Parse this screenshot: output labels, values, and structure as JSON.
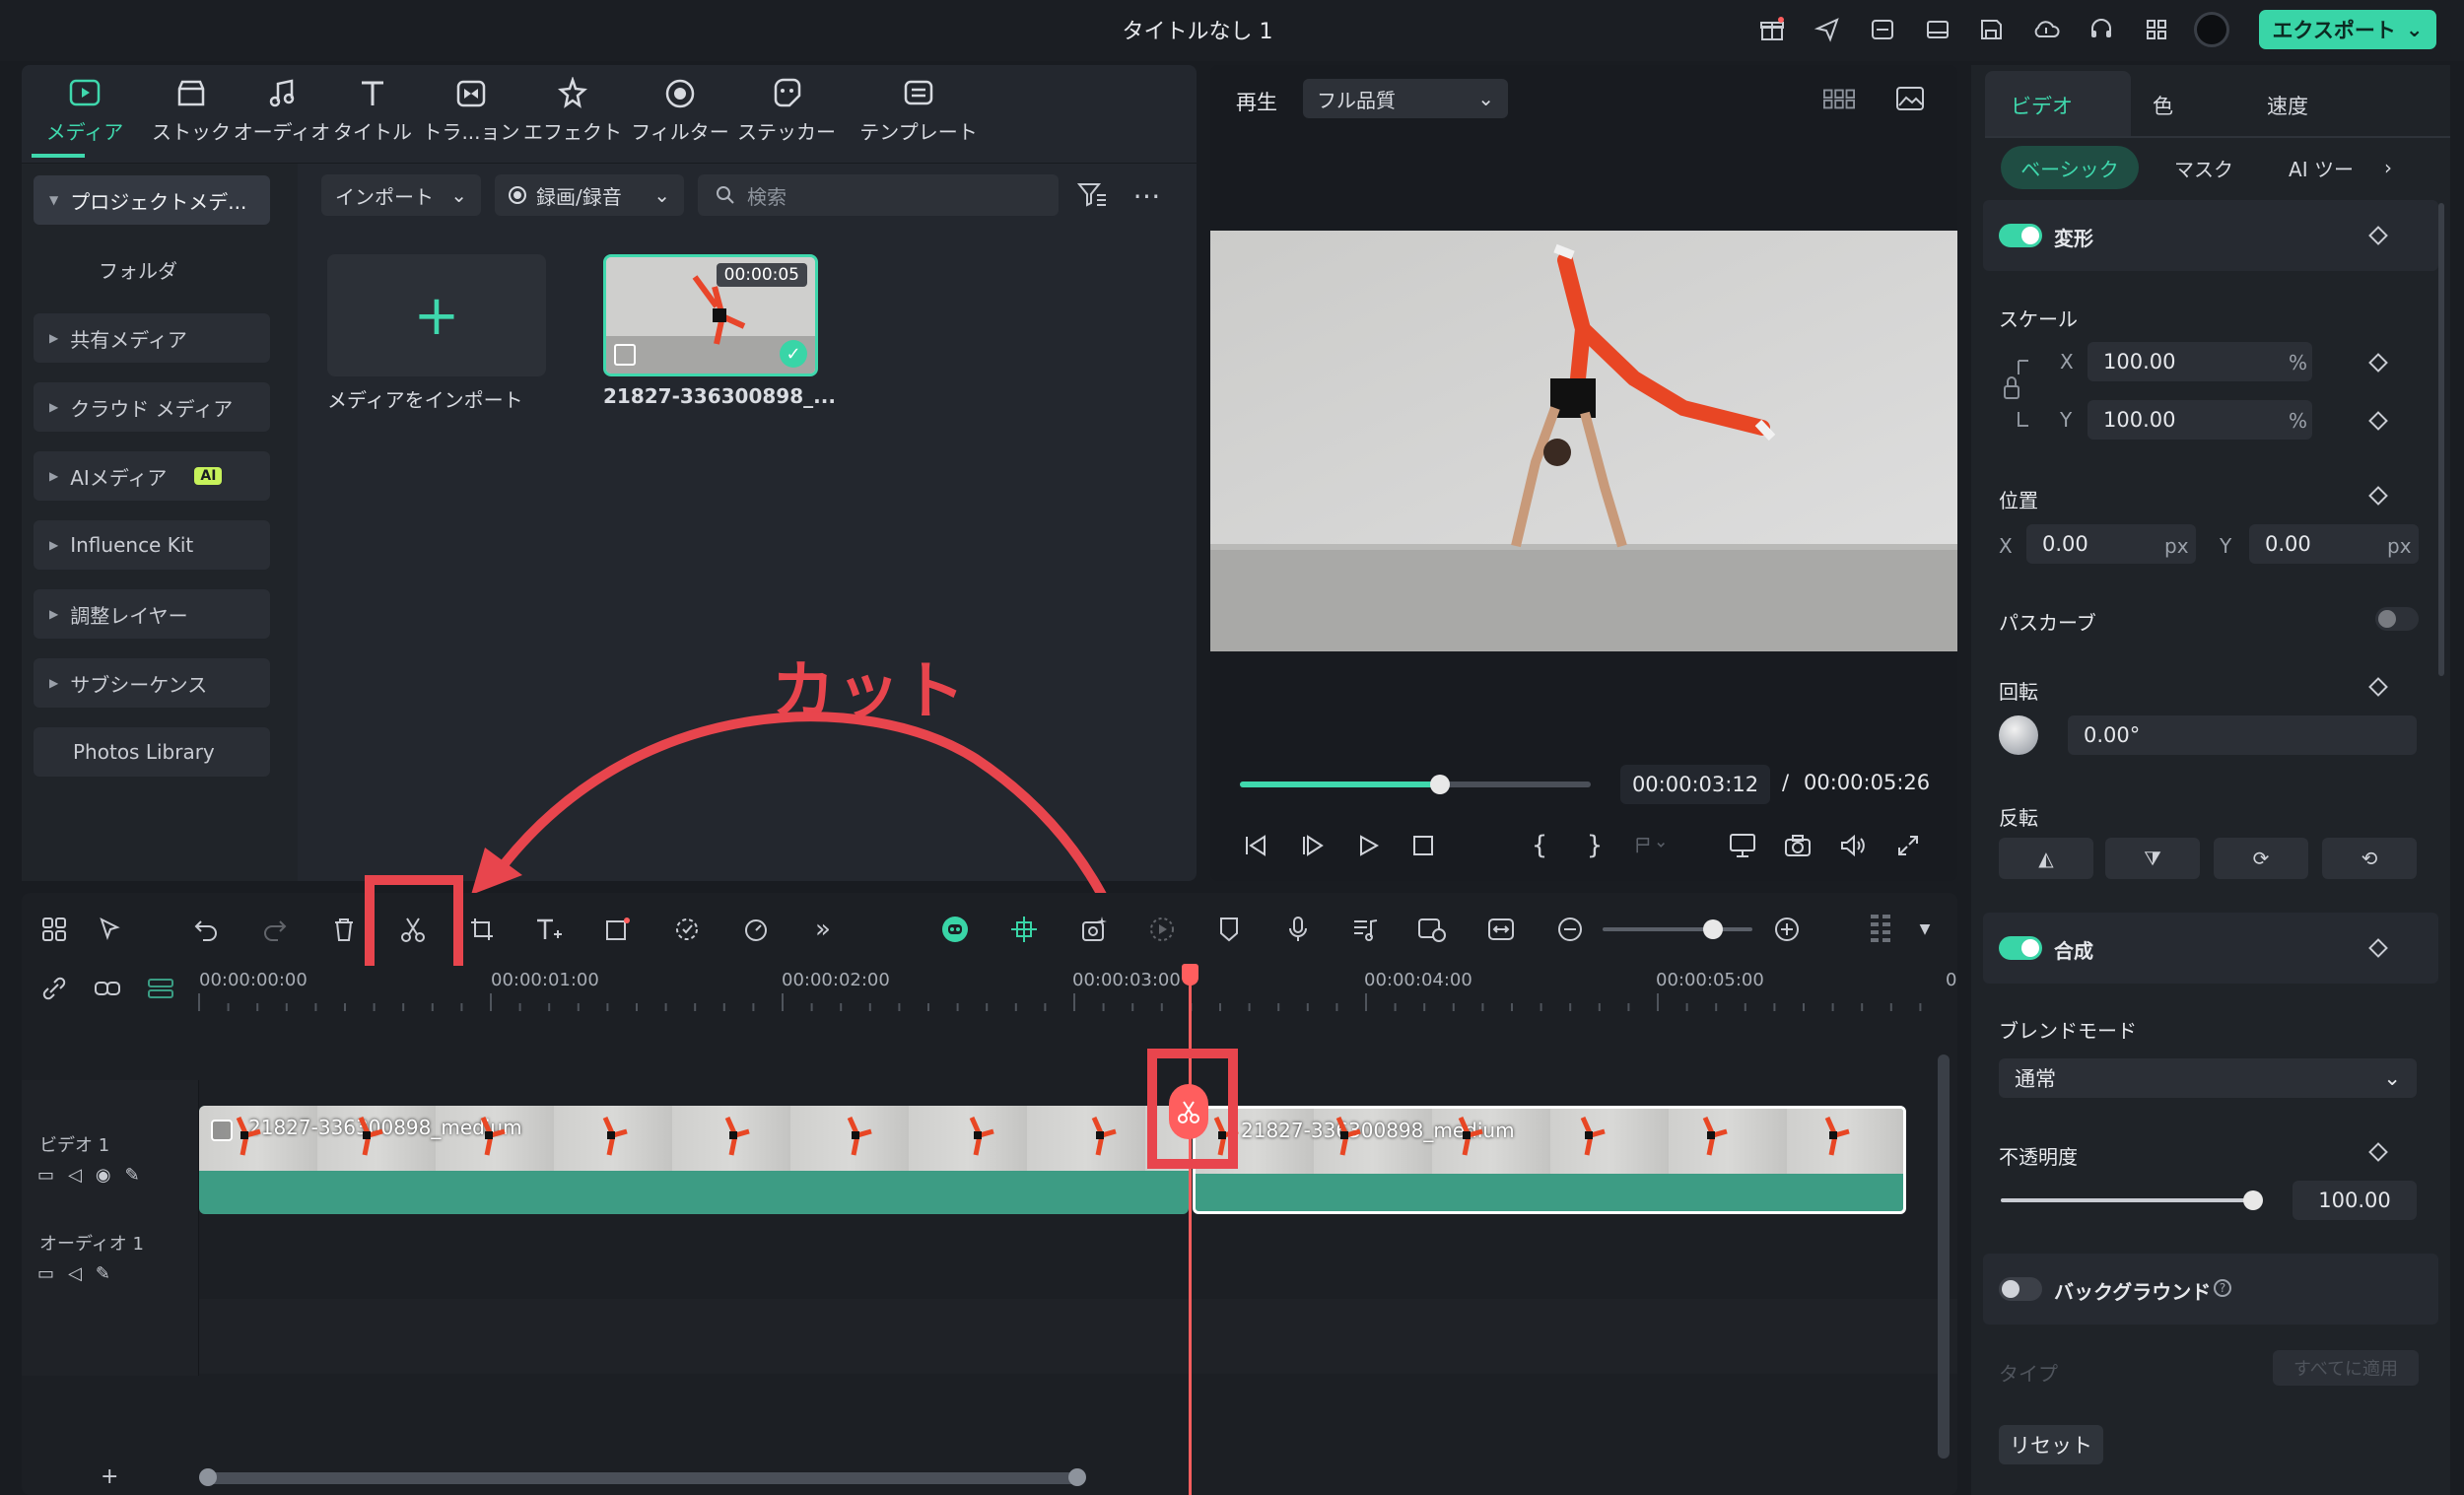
{
  "window": {
    "title": "タイトルなし 1",
    "export_label": "エクスポート"
  },
  "toolbar": {
    "tabs": [
      "メディア",
      "ストック",
      "オーディオ",
      "タイトル",
      "トラ...ョン",
      "エフェクト",
      "フィルター",
      "ステッカー",
      "テンプレート"
    ],
    "active_index": 0
  },
  "sidebar": {
    "items": [
      {
        "label": "プロジェクトメデ..."
      },
      {
        "label": "フォルダ"
      },
      {
        "label": "共有メディア"
      },
      {
        "label": "クラウド メディア"
      },
      {
        "label": "AIメディア",
        "badge": "AI"
      },
      {
        "label": "Influence Kit"
      },
      {
        "label": "調整レイヤー"
      },
      {
        "label": "サブシーケンス"
      },
      {
        "label": "Photos Library"
      }
    ]
  },
  "media_bar": {
    "import_label": "インポート",
    "record_label": "録画/録音",
    "search_placeholder": "検索"
  },
  "media_items": {
    "import_caption": "メディアをインポート",
    "clip_caption": "21827-336300898_...",
    "clip_duration": "00:00:05"
  },
  "preview": {
    "play_label": "再生",
    "quality": "フル品質",
    "current_time": "00:00:03:12",
    "separator": "/",
    "total_time": "00:00:05:26",
    "progress": 0.57
  },
  "props": {
    "tabs": [
      "ビデオ",
      "色",
      "速度"
    ],
    "subtabs": [
      "ベーシック",
      "マスク",
      "AI ツー"
    ],
    "transform_label": "変形",
    "scale_label": "スケール",
    "scale_x": "100.00",
    "scale_y": "100.00",
    "percent": "%",
    "x_label": "X",
    "y_label": "Y",
    "position_label": "位置",
    "pos_x": "0.00",
    "pos_y": "0.00",
    "px": "px",
    "path_curve_label": "パスカーブ",
    "rotation_label": "回転",
    "rotation": "0.00°",
    "flip_label": "反転",
    "composite_label": "合成",
    "blend_label": "ブレンドモード",
    "blend_value": "通常",
    "opacity_label": "不透明度",
    "opacity": "100.00",
    "opacity_level": 1.0,
    "background_label": "バックグラウンド",
    "type_label": "タイプ",
    "apply_all": "すべてに適用",
    "reset_label": "リセット"
  },
  "timeline": {
    "ruler": [
      "00:00:00:00",
      "00:00:01:00",
      "00:00:02:00",
      "00:00:03:00",
      "00:00:04:00",
      "00:00:05:00",
      "0"
    ],
    "video_track": "ビデオ 1",
    "audio_track": "オーディオ 1",
    "clip_left_name": "21827-336300898_medium",
    "clip_right_name": "21827-336300898_medium",
    "add_track": "+"
  },
  "annotation": {
    "text": "カット",
    "color": "#e8454d"
  },
  "colors": {
    "accent": "#39d5a7",
    "playhead": "#ff5e5e",
    "annotation": "#e8454d"
  }
}
